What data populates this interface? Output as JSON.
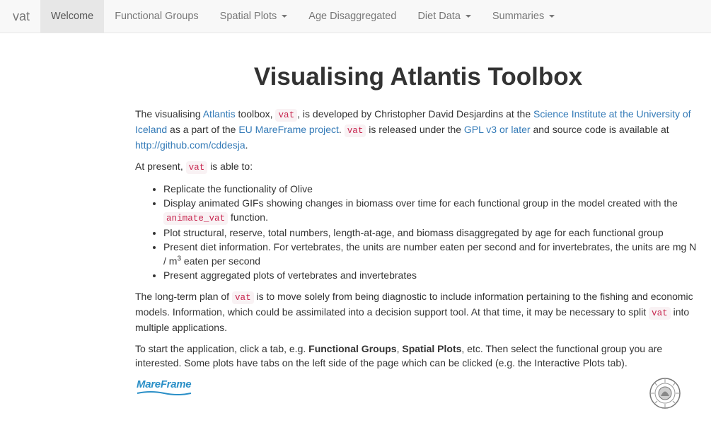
{
  "navbar": {
    "brand": "vat",
    "items": [
      {
        "label": "Welcome",
        "active": true,
        "dropdown": false
      },
      {
        "label": "Functional Groups",
        "active": false,
        "dropdown": false
      },
      {
        "label": "Spatial Plots",
        "active": false,
        "dropdown": true
      },
      {
        "label": "Age Disaggregated",
        "active": false,
        "dropdown": false
      },
      {
        "label": "Diet Data",
        "active": false,
        "dropdown": true
      },
      {
        "label": "Summaries",
        "active": false,
        "dropdown": true
      }
    ]
  },
  "main": {
    "title": "Visualising Atlantis Toolbox",
    "intro": {
      "t1": "The visualising ",
      "link_atlantis": "Atlantis",
      "t2": " toolbox, ",
      "code1": "vat",
      "t3": ", is developed by Christopher David Desjardins at the ",
      "link_institute": "Science Institute at the University of Iceland",
      "t4": " as a part of the ",
      "link_mareframe": "EU MareFrame project",
      "t5": ". ",
      "code2": "vat",
      "t6": " is released under the ",
      "link_gpl": "GPL v3 or later",
      "t7": " and source code is available at ",
      "link_github": "http://github.com/cddesja",
      "t8": "."
    },
    "present": {
      "t1": "At present, ",
      "code": "vat",
      "t2": " is able to:"
    },
    "bullets": {
      "b1": "Replicate the functionality of Olive",
      "b2_t1": "Display animated GIFs showing changes in biomass over time for each functional group in the model created with the ",
      "b2_code": "animate_vat",
      "b2_t2": " function.",
      "b3": "Plot structural, reserve, total numbers, length-at-age, and biomass disaggregated by age for each functional group",
      "b4_t1": "Present diet information. For vertebrates, the units are number eaten per second and for invertebrates, the units are mg N / m",
      "b4_sup": "3",
      "b4_t2": " eaten per second",
      "b5": "Present aggregated plots of vertebrates and invertebrates"
    },
    "plan": {
      "t1": "The long-term plan of ",
      "code1": "vat",
      "t2": " is to move solely from being diagnostic to include information pertaining to the fishing and economic models. Information, which could be assimilated into a decision support tool. At that time, it may be necessary to split ",
      "code2": "vat",
      "t3": " into multiple applications."
    },
    "start": {
      "t1": "To start the application, click a tab, e.g. ",
      "b1": "Functional Groups",
      "t2": ", ",
      "b2": "Spatial Plots",
      "t3": ", etc. Then select the functional group you are interested. Some plots have tabs on the left side of the page which can be clicked (e.g. the Interactive Plots tab)."
    },
    "logos": {
      "mareframe": "MareFrame",
      "seal_text": "UNIVERSITATIS ISLANDIAE"
    }
  },
  "colors": {
    "link": "#337ab7",
    "code_text": "#c7254e",
    "code_bg": "#f9f2f4",
    "navbar_bg": "#f8f8f8",
    "active_tab_bg": "#e7e7e7"
  }
}
